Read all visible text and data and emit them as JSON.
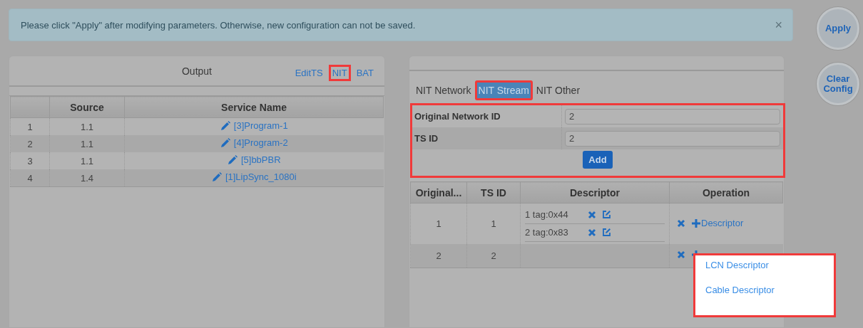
{
  "alert": {
    "text": "Please click \"Apply\" after modifying parameters. Otherwise, new configuration can not be saved.",
    "close": "×"
  },
  "actions": [
    {
      "label": "Apply"
    },
    {
      "label": "Clear Config"
    }
  ],
  "output_panel": {
    "title": "Output",
    "links": [
      {
        "label": "EditTS",
        "highlighted": false
      },
      {
        "label": "NIT",
        "highlighted": true
      },
      {
        "label": "BAT",
        "highlighted": false
      }
    ],
    "columns": [
      "",
      "Source",
      "Service Name"
    ],
    "rows": [
      {
        "index": "1",
        "source": "1.1",
        "service": "[3]Program-1"
      },
      {
        "index": "2",
        "source": "1.1",
        "service": "[4]Program-2"
      },
      {
        "index": "3",
        "source": "1.1",
        "service": "[5]bbPBR"
      },
      {
        "index": "4",
        "source": "1.4",
        "service": "[1]LipSync_1080i"
      }
    ]
  },
  "nit_panel": {
    "tabs": [
      {
        "label": "NIT Network",
        "selected": false,
        "highlighted": false
      },
      {
        "label": "NIT Stream",
        "selected": true,
        "highlighted": true
      },
      {
        "label": "NIT Other",
        "selected": false,
        "highlighted": false
      }
    ],
    "form": {
      "highlighted": true,
      "fields": [
        {
          "label": "Original Network ID",
          "value": "2"
        },
        {
          "label": "TS ID",
          "value": "2"
        }
      ],
      "add_button": "Add"
    },
    "columns": [
      "Original...",
      "TS ID",
      "Descriptor",
      "Operation"
    ],
    "rows": [
      {
        "original_network_id": "1",
        "ts_id": "1",
        "descriptors": [
          {
            "label": "1 tag:0x44"
          },
          {
            "label": "2 tag:0x83"
          }
        ],
        "op_link": "Descriptor"
      },
      {
        "original_network_id": "2",
        "ts_id": "2",
        "descriptors": []
      }
    ],
    "menu": {
      "highlighted": true,
      "items": [
        {
          "label": "LCN Descriptor"
        },
        {
          "label": "Cable Descriptor"
        }
      ]
    }
  }
}
